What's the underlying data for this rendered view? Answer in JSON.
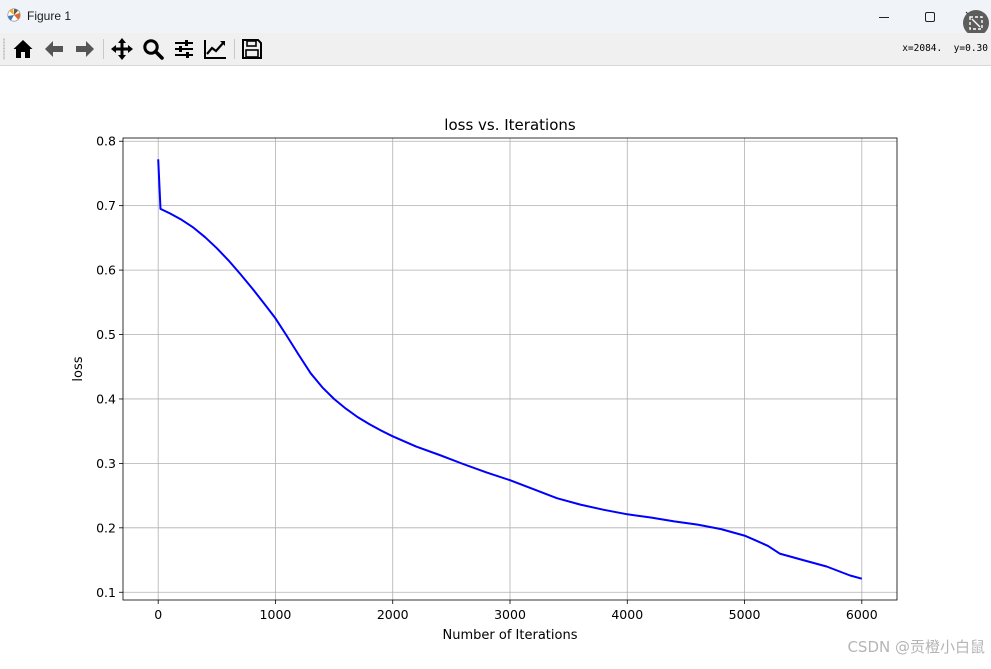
{
  "window": {
    "title": "Figure 1",
    "icons": [
      "matplotlib-logo-icon",
      "minimize-icon",
      "maximize-icon",
      "close-icon",
      "screenshot-overlay-icon"
    ]
  },
  "toolbar": {
    "buttons": [
      {
        "name": "home",
        "icon": "home-icon"
      },
      {
        "name": "back",
        "icon": "arrow-left-icon"
      },
      {
        "name": "forward",
        "icon": "arrow-right-icon"
      },
      {
        "name": "pan",
        "icon": "move-arrows-icon"
      },
      {
        "name": "zoom",
        "icon": "magnifier-icon"
      },
      {
        "name": "subplots",
        "icon": "sliders-icon"
      },
      {
        "name": "edit-axes",
        "icon": "line-chart-icon"
      },
      {
        "name": "save",
        "icon": "floppy-disk-icon"
      }
    ],
    "coords": "x=2084.  y=0.30"
  },
  "chart_data": {
    "type": "line",
    "title": "loss vs. Iterations",
    "xlabel": "Number of Iterations",
    "ylabel": "loss",
    "xlim": [
      -300,
      6300
    ],
    "ylim": [
      0.088,
      0.805
    ],
    "xticks": [
      0,
      1000,
      2000,
      3000,
      4000,
      5000,
      6000
    ],
    "xtick_labels": [
      "0",
      "1000",
      "2000",
      "3000",
      "4000",
      "5000",
      "6000"
    ],
    "yticks": [
      0.1,
      0.2,
      0.3,
      0.4,
      0.5,
      0.6,
      0.7,
      0.8
    ],
    "ytick_labels": [
      "0.1",
      "0.2",
      "0.3",
      "0.4",
      "0.5",
      "0.6",
      "0.7",
      "0.8"
    ],
    "grid": true,
    "series": [
      {
        "color": "#0000ff",
        "x": [
          0,
          20,
          100,
          200,
          300,
          400,
          500,
          600,
          700,
          800,
          900,
          1000,
          1100,
          1200,
          1300,
          1400,
          1500,
          1600,
          1700,
          1800,
          1900,
          2000,
          2200,
          2400,
          2600,
          2800,
          3000,
          3200,
          3400,
          3600,
          3800,
          4000,
          4200,
          4400,
          4600,
          4800,
          5000,
          5100,
          5200,
          5300,
          5500,
          5700,
          5900,
          6000
        ],
        "y": [
          0.772,
          0.695,
          0.688,
          0.678,
          0.666,
          0.651,
          0.634,
          0.615,
          0.594,
          0.572,
          0.549,
          0.525,
          0.497,
          0.468,
          0.44,
          0.418,
          0.4,
          0.385,
          0.372,
          0.361,
          0.351,
          0.342,
          0.326,
          0.313,
          0.299,
          0.286,
          0.274,
          0.26,
          0.246,
          0.236,
          0.228,
          0.221,
          0.216,
          0.21,
          0.205,
          0.198,
          0.188,
          0.18,
          0.172,
          0.16,
          0.15,
          0.14,
          0.126,
          0.121
        ]
      }
    ]
  },
  "watermark": "CSDN @贡橙小白鼠"
}
